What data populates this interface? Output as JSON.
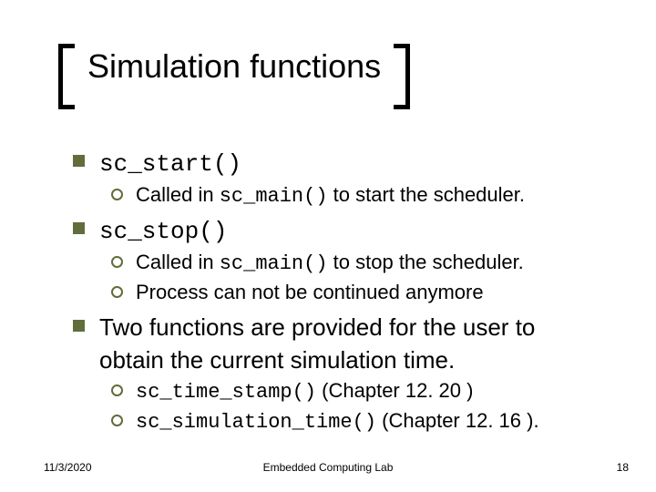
{
  "title": "Simulation functions",
  "items": [
    {
      "label_code": "sc_start()",
      "label_plain": "",
      "sub": [
        {
          "pre": "Called in ",
          "code": "sc_main()",
          "post": " to start the scheduler."
        }
      ]
    },
    {
      "label_code": "sc_stop()",
      "label_plain": "",
      "sub": [
        {
          "pre": "Called in ",
          "code": "sc_main()",
          "post": " to stop the scheduler."
        },
        {
          "pre": "Process can not be continued anymore",
          "code": "",
          "post": ""
        }
      ]
    },
    {
      "label_code": "",
      "label_plain": "Two functions are provided for the user to obtain the current simulation time.",
      "sub": [
        {
          "pre": "",
          "code": "sc_time_stamp()",
          "post": " (Chapter 12. 20 )"
        },
        {
          "pre": "",
          "code": "sc_simulation_time()",
          "post": " (Chapter 12. 16 )."
        }
      ]
    }
  ],
  "footer": {
    "date": "11/3/2020",
    "center": "Embedded Computing Lab",
    "page": "18"
  }
}
